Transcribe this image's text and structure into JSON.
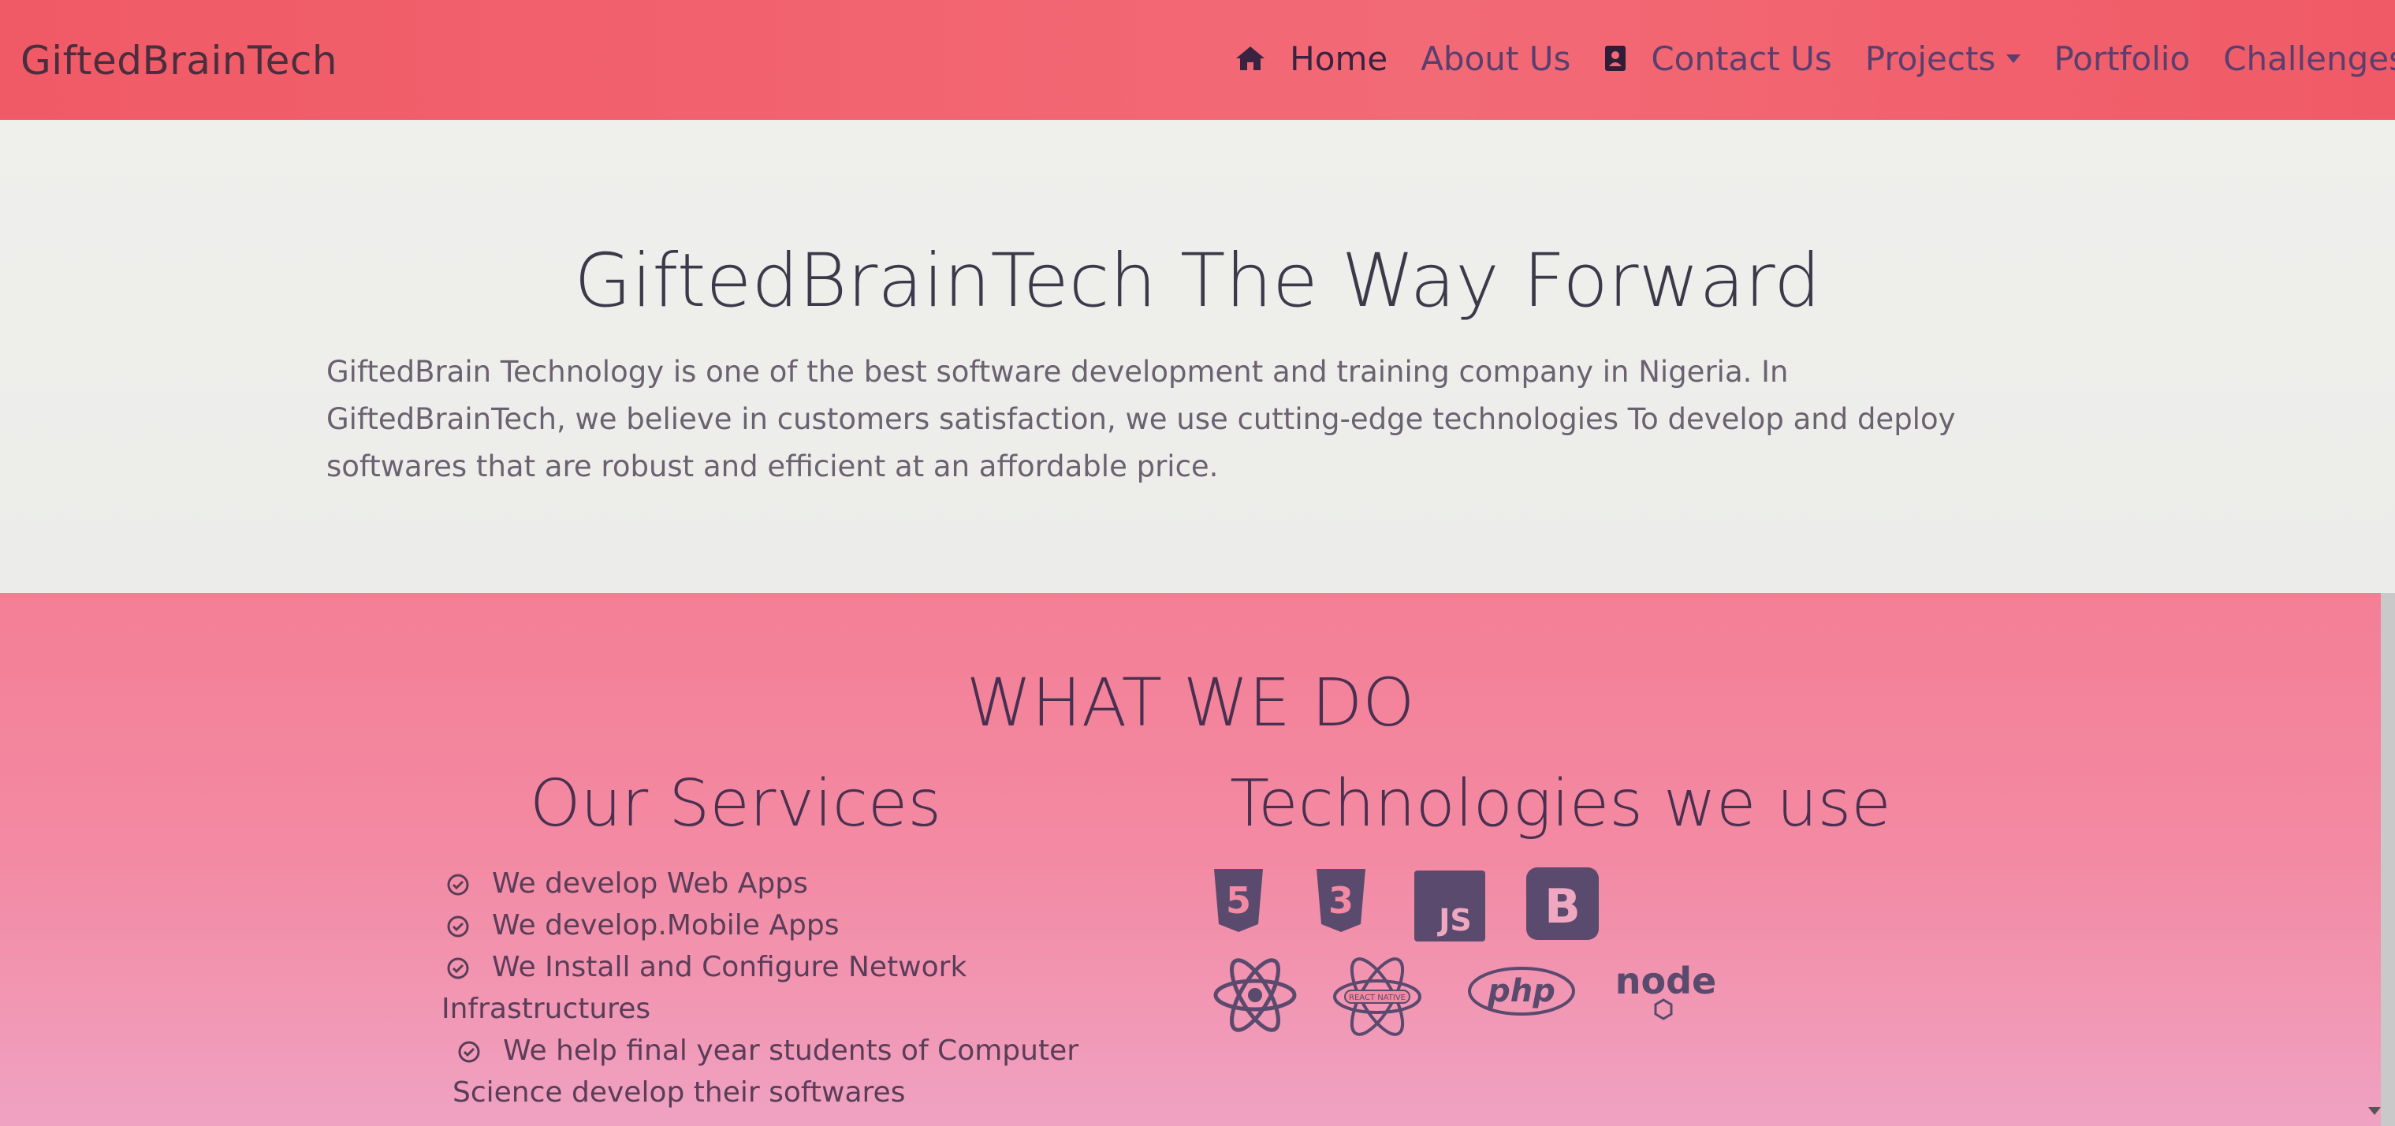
{
  "navbar": {
    "brand": "GiftedBrainTech",
    "links": [
      {
        "label": "Home",
        "icon": "home-icon"
      },
      {
        "label": "About Us"
      },
      {
        "label": "Contact Us",
        "icon": "contact-book-icon"
      },
      {
        "label": "Projects",
        "icon": "caret-down-icon"
      },
      {
        "label": "Portfolio"
      },
      {
        "label": "Challenges"
      }
    ]
  },
  "hero": {
    "title": "GiftedBrainTech The Way Forward",
    "description": "GiftedBrain Technology is one of the best software development and training company in Nigeria. In GiftedBrainTech, we believe in customers satisfaction, we use cutting-edge technologies To develop and deploy softwares that are robust and efficient at an affordable price."
  },
  "what_we_do": {
    "title": "WHAT WE DO",
    "services": {
      "title": "Our Services",
      "items": [
        {
          "line1": "We develop Web Apps",
          "line2": ""
        },
        {
          "line1": "We develop.Mobile Apps",
          "line2": ""
        },
        {
          "line1": "We Install and Configure Network",
          "line2": "Infrastructures"
        },
        {
          "line1": "We help final year students of Computer",
          "line2": "Science develop their softwares"
        }
      ]
    },
    "technologies": {
      "title": "Technologies we use",
      "icons": [
        {
          "name": "html5-icon",
          "label": "5"
        },
        {
          "name": "css3-icon",
          "label": "3"
        },
        {
          "name": "javascript-icon",
          "label": "JS"
        },
        {
          "name": "bootstrap-icon",
          "label": "B"
        },
        {
          "name": "react-icon",
          "label": ""
        },
        {
          "name": "react-native-icon",
          "label": "REACT NATIVE"
        },
        {
          "name": "php-icon",
          "label": "php"
        },
        {
          "name": "nodejs-icon",
          "label": "node"
        }
      ]
    }
  },
  "colors": {
    "navbar": "#f05a66",
    "hero_bg": "#eeeeeb",
    "section_bg": "#f38aa3",
    "icon_fill": "#5a4a6e"
  }
}
